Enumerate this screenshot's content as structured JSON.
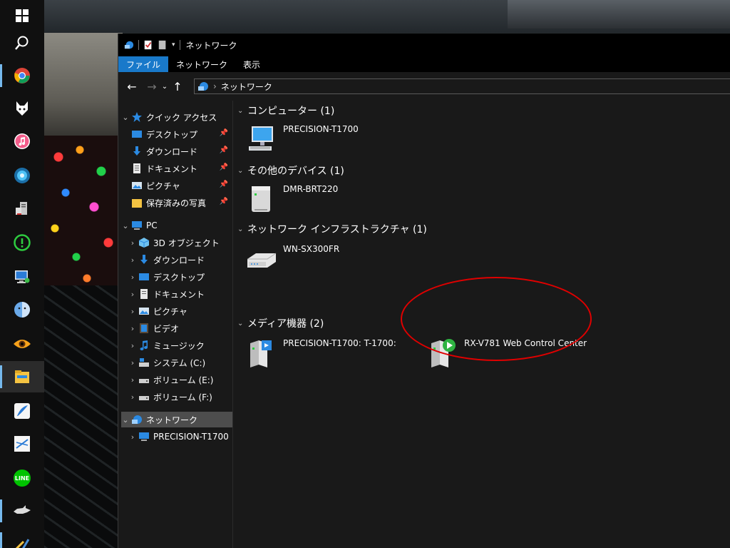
{
  "window": {
    "title": "ネットワーク"
  },
  "ribbon": {
    "tabs": [
      "ファイル",
      "ネットワーク",
      "表示"
    ]
  },
  "address": {
    "location": "ネットワーク"
  },
  "nav": {
    "quick_access": "クイック アクセス",
    "quick_items": [
      "デスクトップ",
      "ダウンロード",
      "ドキュメント",
      "ピクチャ",
      "保存済みの写真"
    ],
    "pc": "PC",
    "pc_items": [
      "3D オブジェクト",
      "ダウンロード",
      "デスクトップ",
      "ドキュメント",
      "ピクチャ",
      "ビデオ",
      "ミュージック",
      "システム (C:)",
      "ボリューム (E:)",
      "ボリューム (F:)"
    ],
    "network": "ネットワーク",
    "network_items": [
      "PRECISION-T1700"
    ]
  },
  "groups": [
    {
      "header": "コンピューター (1)",
      "items": [
        "PRECISION-T1700"
      ]
    },
    {
      "header": "その他のデバイス (1)",
      "items": [
        "DMR-BRT220"
      ]
    },
    {
      "header": "ネットワーク インフラストラクチャ (1)",
      "items": [
        "WN-SX300FR"
      ]
    },
    {
      "header": "メディア機器 (2)",
      "items": [
        "PRECISION-T1700: T-1700:",
        "RX-V781 Web Control Center"
      ]
    }
  ],
  "colors": {
    "ribbon_active": "#1979ca",
    "highlight": "#e00000",
    "taskbar_indicator": "#76b9ed"
  },
  "taskbar_icons": [
    "windows-start-icon",
    "search-icon",
    "chrome-icon",
    "foobar-icon",
    "itunes-icon",
    "orb-icon",
    "server-icon",
    "green-alert-icon",
    "network-monitor-icon",
    "finder-icon",
    "eye-icon",
    "file-explorer-icon",
    "feather-icon",
    "drawing-icon",
    "line-icon",
    "shark-icon",
    "tools-icon"
  ]
}
